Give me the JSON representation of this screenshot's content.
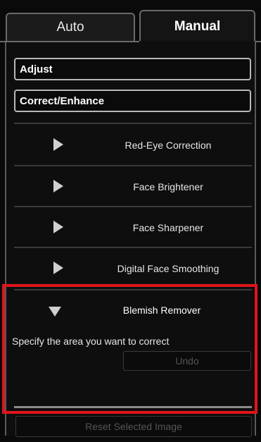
{
  "tabs": {
    "auto": "Auto",
    "manual": "Manual"
  },
  "sections": {
    "adjust": "Adjust",
    "correct": "Correct/Enhance"
  },
  "tools": [
    {
      "label": "Red-Eye Correction"
    },
    {
      "label": "Face Brightener"
    },
    {
      "label": "Face Sharpener"
    },
    {
      "label": "Digital Face Smoothing"
    }
  ],
  "expanded": {
    "title": "Blemish Remover",
    "hint": "Specify the area you want to correct",
    "undo": "Undo"
  },
  "footer": {
    "reset": "Reset Selected Image"
  },
  "colors": {
    "highlight": "#e0151b"
  }
}
